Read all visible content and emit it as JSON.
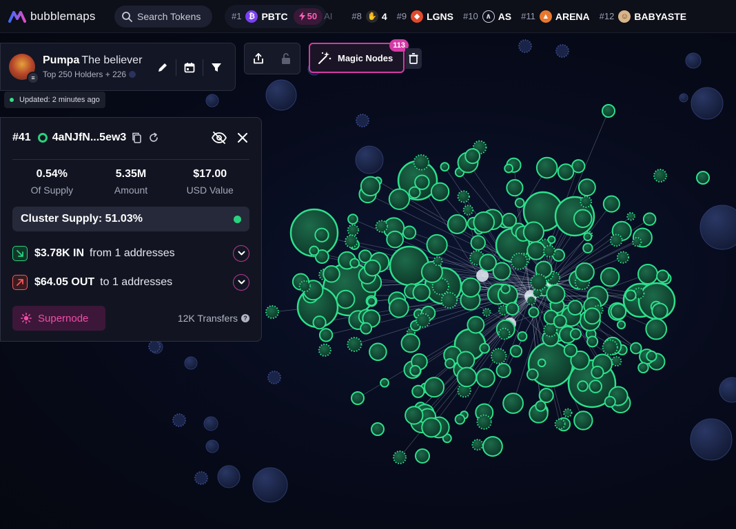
{
  "app": {
    "name": "bubblemaps"
  },
  "search": {
    "placeholder": "Search Tokens"
  },
  "trending": [
    {
      "rank": "#1",
      "name": "PBTC",
      "icon": "bitcoin-icon",
      "color": "#7b3ff2",
      "boost": "50"
    },
    {
      "rank": "#8",
      "name": "4",
      "icon": "hand-icon",
      "color": "#2a2a2a"
    },
    {
      "rank": "#9",
      "name": "LGNS",
      "icon": "lgns-icon",
      "color": "#e14a2b"
    },
    {
      "rank": "#10",
      "name": "AS",
      "icon": "as-icon",
      "color": "#cfd3e0"
    },
    {
      "rank": "#11",
      "name": "ARENA",
      "icon": "arena-icon",
      "color": "#e8772e"
    },
    {
      "rank": "#12",
      "name": "BABYASTE",
      "icon": "babyaste-icon",
      "color": "#d9b489"
    }
  ],
  "trending_fade": "AI",
  "profile": {
    "name": "Pumpa",
    "subtitle": "The believer",
    "holders": "Top 250 Holders + 226",
    "updated": "Updated: 2 minutes ago"
  },
  "magic_nodes": {
    "label": "Magic Nodes",
    "count": "113"
  },
  "holder": {
    "rank": "#41",
    "address": "4aNJfN...5ew3",
    "stats": [
      {
        "value": "0.54%",
        "label": "Of Supply"
      },
      {
        "value": "5.35M",
        "label": "Amount"
      },
      {
        "value": "$17.00",
        "label": "USD Value"
      }
    ],
    "cluster_supply": "Cluster Supply: 51.03%",
    "in": {
      "amount": "$3.78K IN",
      "text": "from 1 addresses"
    },
    "out": {
      "amount": "$64.05 OUT",
      "text": "to 1 addresses"
    },
    "supernode": "Supernode",
    "transfers": "12K Transfers"
  },
  "colors": {
    "accent_green": "#28d37d",
    "accent_pink": "#d43ba6",
    "panel_bg": "#121521",
    "idle_bubble": "#1e2a55"
  }
}
